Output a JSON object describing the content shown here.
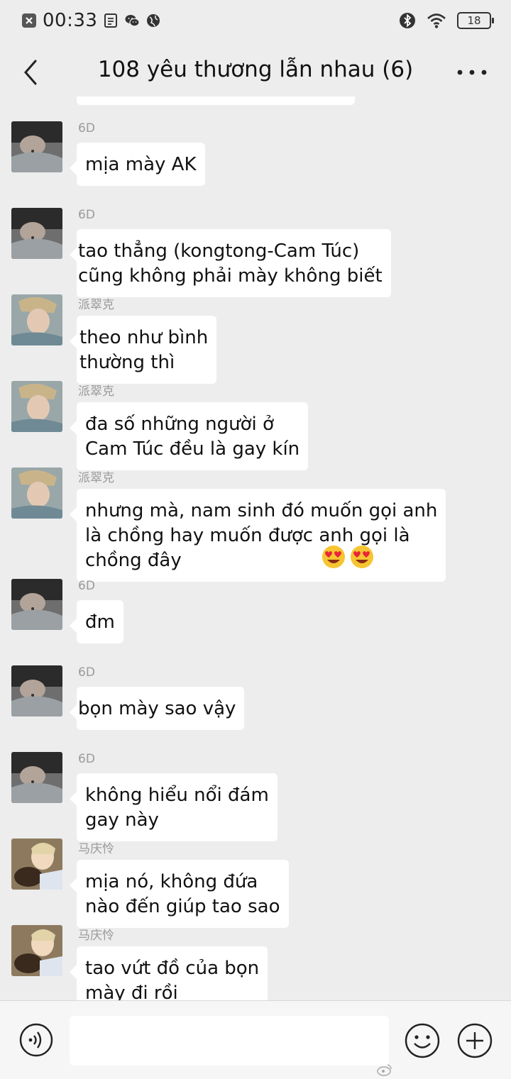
{
  "status_bar": {
    "time": "00:33",
    "battery": "18",
    "left_icons": [
      "close-box-icon",
      "sim-icon",
      "wechat-icon",
      "globe-icon"
    ],
    "right_icons": [
      "bluetooth-icon",
      "wifi-icon",
      "battery-icon"
    ]
  },
  "header": {
    "title": "108 yêu thương lẫn nhau (6)",
    "back_icon": "chevron-left-icon",
    "more_icon": "more-dots-icon"
  },
  "messages": [
    {
      "sender": "6D",
      "text": "mịa mày AK",
      "avatar": "avatar-6d"
    },
    {
      "sender": "6D",
      "text": "tao thẳng (kongtong-Cam Túc)\ncũng không phải mày không biết",
      "avatar": "avatar-6d"
    },
    {
      "sender": "派翠克",
      "text": "theo như bình\nthường thì",
      "avatar": "avatar-patrick"
    },
    {
      "sender": "派翠克",
      "text": "đa số những người ở\nCam Túc đều là gay kín",
      "avatar": "avatar-patrick"
    },
    {
      "sender": "派翠克",
      "text": "nhưng mà, nam sinh đó muốn gọi anh\nlà chồng hay muốn được anh gọi là\nchồng đây",
      "avatar": "avatar-patrick",
      "emojis": [
        "heart-eyes-emoji",
        "heart-eyes-emoji"
      ]
    },
    {
      "sender": "6D",
      "text": "đm",
      "avatar": "avatar-6d"
    },
    {
      "sender": "6D",
      "text": "bọn mày sao vậy",
      "avatar": "avatar-6d"
    },
    {
      "sender": "6D",
      "text": "không hiểu nổi đám\ngay này",
      "avatar": "avatar-6d"
    },
    {
      "sender": "马庆怜",
      "text": "mịa nó, không đứa\nnào đến giúp tao sao",
      "avatar": "avatar-ma"
    },
    {
      "sender": "马庆怜",
      "text": "tao vứt đồ của bọn\nmày đi rồi",
      "avatar": "avatar-ma"
    }
  ],
  "input_bar": {
    "placeholder": "",
    "icons": [
      "voice-icon",
      "emoji-icon",
      "plus-icon"
    ]
  }
}
